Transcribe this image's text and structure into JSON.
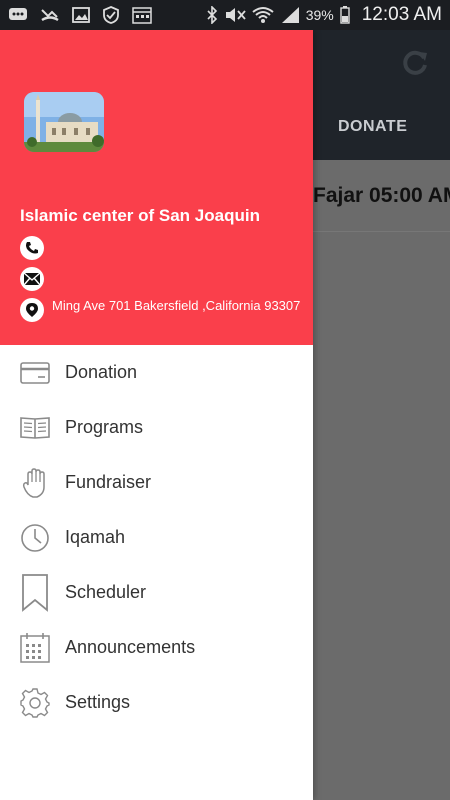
{
  "status_bar": {
    "battery_percent": "39%",
    "time": "12:03 AM"
  },
  "background": {
    "tab_label": "DONATE",
    "prayer_time_text": "Fajar 05:00 AM"
  },
  "drawer": {
    "org_name": "Islamic center of San Joaquin",
    "address": "Ming Ave 701 Bakersfield ,California 93307",
    "header_color": "#fa3f4b",
    "menu": [
      {
        "label": "Donation",
        "icon": "credit-card-icon"
      },
      {
        "label": "Programs",
        "icon": "book-icon"
      },
      {
        "label": "Fundraiser",
        "icon": "hand-icon"
      },
      {
        "label": "Iqamah",
        "icon": "clock-icon"
      },
      {
        "label": "Scheduler",
        "icon": "bookmark-icon"
      },
      {
        "label": "Announcements",
        "icon": "calendar-icon"
      },
      {
        "label": "Settings",
        "icon": "gear-icon"
      }
    ]
  }
}
